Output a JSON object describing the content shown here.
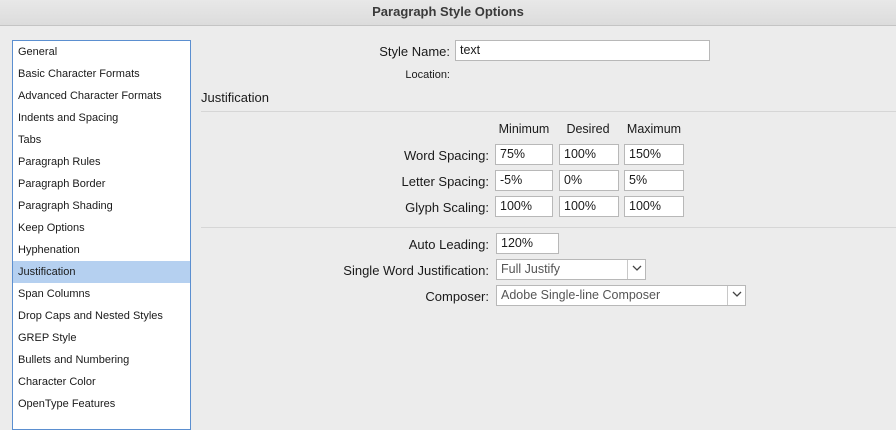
{
  "window": {
    "title": "Paragraph Style Options"
  },
  "sidebar": {
    "items": [
      {
        "label": "General"
      },
      {
        "label": "Basic Character Formats"
      },
      {
        "label": "Advanced Character Formats"
      },
      {
        "label": "Indents and Spacing"
      },
      {
        "label": "Tabs"
      },
      {
        "label": "Paragraph Rules"
      },
      {
        "label": "Paragraph Border"
      },
      {
        "label": "Paragraph Shading"
      },
      {
        "label": "Keep Options"
      },
      {
        "label": "Hyphenation"
      },
      {
        "label": "Justification",
        "selected": true
      },
      {
        "label": "Span Columns"
      },
      {
        "label": "Drop Caps and Nested Styles"
      },
      {
        "label": "GREP Style"
      },
      {
        "label": "Bullets and Numbering"
      },
      {
        "label": "Character Color"
      },
      {
        "label": "OpenType Features"
      }
    ]
  },
  "header": {
    "style_name_label": "Style Name:",
    "style_name_value": "text",
    "location_label": "Location:"
  },
  "section": {
    "title": "Justification"
  },
  "spacing": {
    "columns": {
      "minimum": "Minimum",
      "desired": "Desired",
      "maximum": "Maximum"
    },
    "word_spacing": {
      "label": "Word Spacing:",
      "minimum": "75%",
      "desired": "100%",
      "maximum": "150%"
    },
    "letter_spacing": {
      "label": "Letter Spacing:",
      "minimum": "-5%",
      "desired": "0%",
      "maximum": "5%"
    },
    "glyph_scaling": {
      "label": "Glyph Scaling:",
      "minimum": "100%",
      "desired": "100%",
      "maximum": "100%"
    }
  },
  "options": {
    "auto_leading_label": "Auto Leading:",
    "auto_leading_value": "120%",
    "single_word_label": "Single Word Justification:",
    "single_word_value": "Full Justify",
    "composer_label": "Composer:",
    "composer_value": "Adobe Single-line Composer"
  },
  "icons": {
    "dropdown": "chevron-down-icon"
  }
}
